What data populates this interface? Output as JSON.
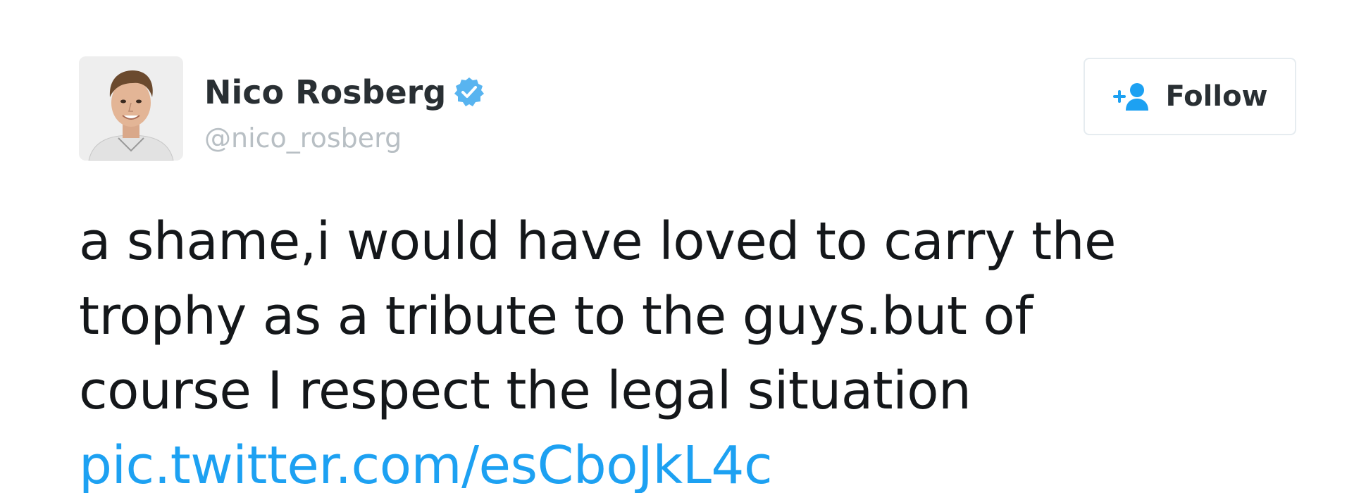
{
  "tweet": {
    "author": {
      "display_name": "Nico Rosberg",
      "handle": "@nico_rosberg",
      "verified": true,
      "avatar_icon": "profile-photo"
    },
    "follow_button": {
      "label": "Follow",
      "icon": "add-user-icon"
    },
    "text_lines": [
      "a shame,i would have loved to carry the",
      "trophy as a tribute to the guys.but of",
      "course I respect the legal situation"
    ],
    "link": "pic.twitter.com/esCboJkL4c"
  },
  "colors": {
    "text": "#14171a",
    "link": "#1da1f2",
    "handle": "#b8bfc4",
    "verified_badge": "#58b4f0",
    "button_border": "#e6ecf0"
  }
}
